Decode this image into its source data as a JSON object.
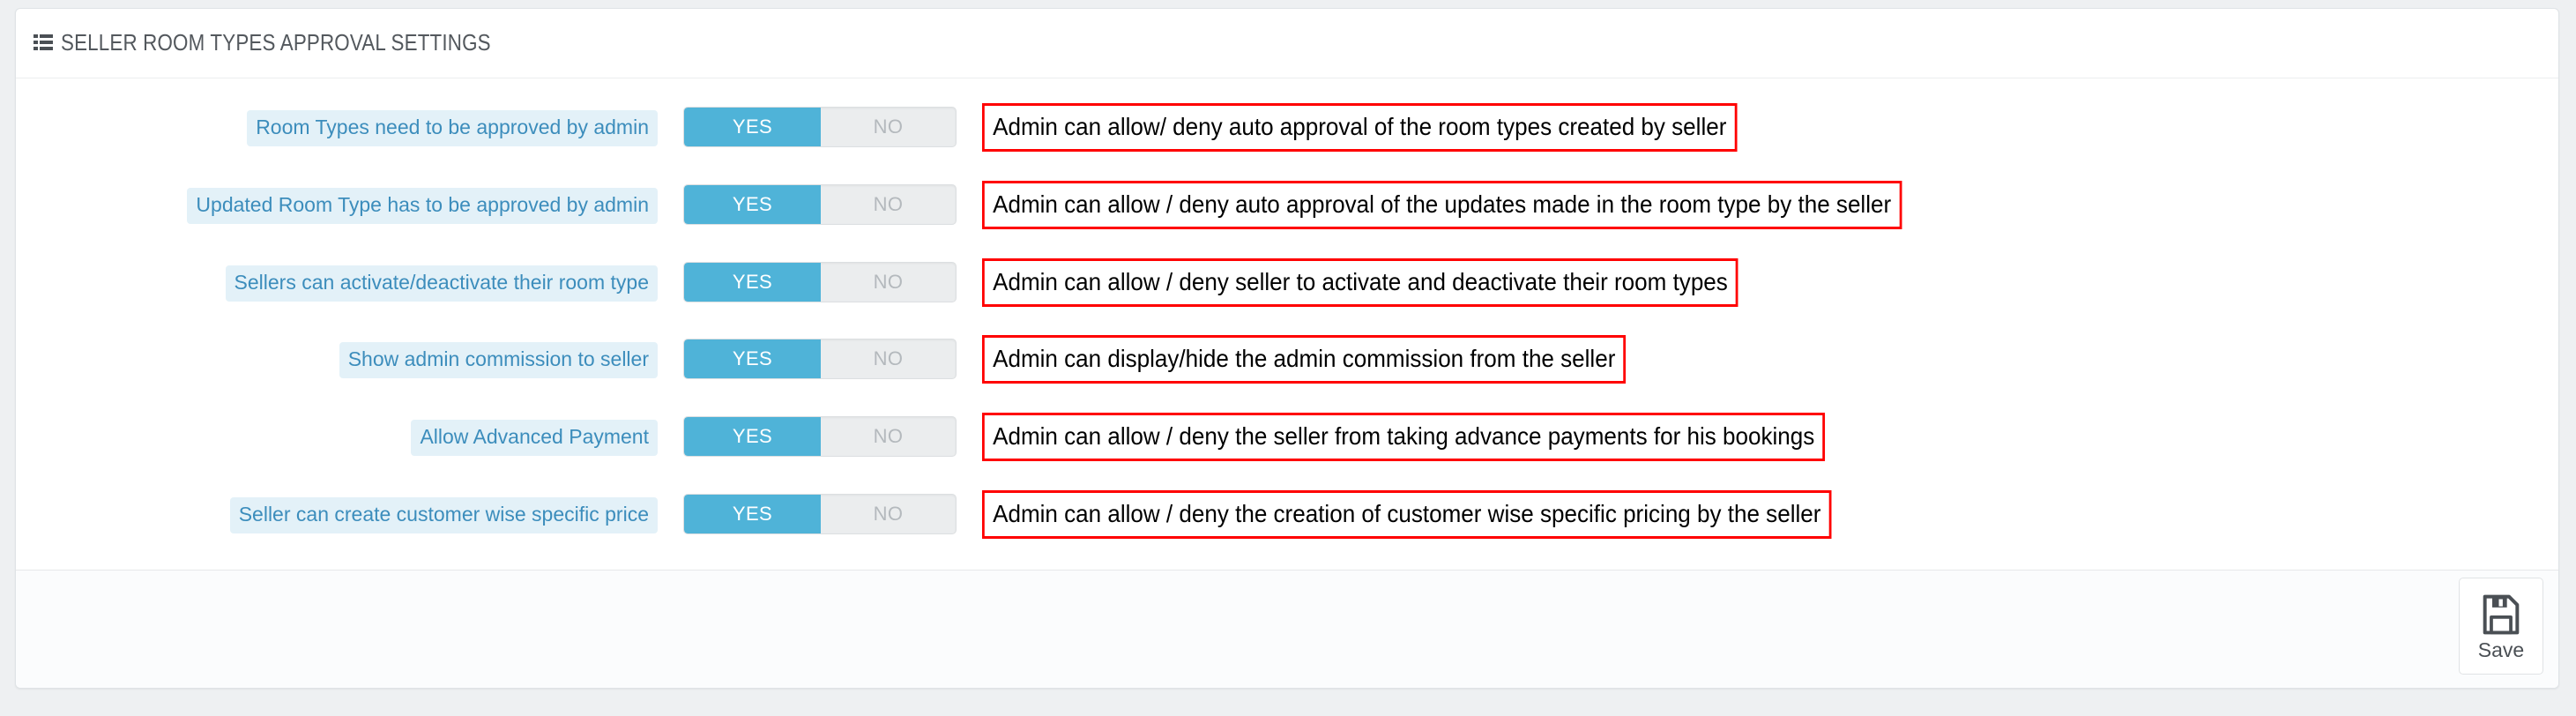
{
  "panel": {
    "title": "SELLER ROOM TYPES APPROVAL SETTINGS",
    "title_icon": "list-ul-icon",
    "accent_color": "#4fb3d8",
    "label_text_color": "#3c8dbc",
    "label_bg_color": "#e3f1f8",
    "annotation_border_color": "#ff0000"
  },
  "toggle": {
    "on_label": "YES",
    "off_label": "NO"
  },
  "rows": [
    {
      "label": "Room Types need to be approved by admin",
      "toggle_value": "YES",
      "annotation": "Admin can allow/ deny auto approval of the room types created by seller"
    },
    {
      "label": "Updated Room Type has to be approved by admin",
      "toggle_value": "YES",
      "annotation": "Admin can allow / deny auto approval of the updates made in the room type by the seller"
    },
    {
      "label": "Sellers can activate/deactivate their room type",
      "toggle_value": "YES",
      "annotation": "Admin can allow / deny seller to activate and deactivate their room types"
    },
    {
      "label": "Show admin commission to seller",
      "toggle_value": "YES",
      "annotation": "Admin can display/hide the admin commission from the seller"
    },
    {
      "label": "Allow Advanced Payment",
      "toggle_value": "YES",
      "annotation": "Admin can allow / deny the seller from taking advance payments for his bookings"
    },
    {
      "label": "Seller can create customer wise specific price",
      "toggle_value": "YES",
      "annotation": "Admin can allow / deny the creation of customer wise specific pricing by the seller"
    }
  ],
  "footer": {
    "save_label": "Save",
    "save_icon": "floppy-disk-icon"
  }
}
